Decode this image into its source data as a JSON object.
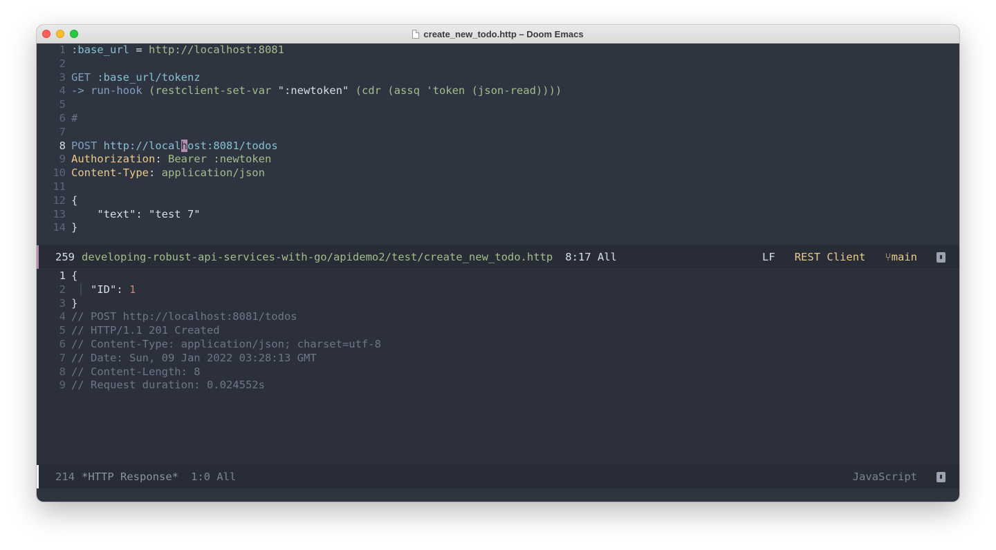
{
  "window": {
    "title": "create_new_todo.http – Doom Emacs"
  },
  "editor": {
    "lines": [
      {
        "n": "1",
        "segments": [
          {
            "t": ":base_url",
            "c": "var"
          },
          {
            "t": " = ",
            "c": "punc"
          },
          {
            "t": "http://localhost:8081",
            "c": "str"
          }
        ]
      },
      {
        "n": "2",
        "segments": []
      },
      {
        "n": "3",
        "segments": [
          {
            "t": "GET",
            "c": "kw"
          },
          {
            "t": " :base_url/tokenz",
            "c": "url"
          }
        ]
      },
      {
        "n": "4",
        "segments": [
          {
            "t": "->",
            "c": "kw"
          },
          {
            "t": " run-hook ",
            "c": "fn"
          },
          {
            "t": "(restclient-set-var ",
            "c": "str"
          },
          {
            "t": "\":newtoken\"",
            "c": "punc"
          },
          {
            "t": " (cdr (assq 'token (json-read))))",
            "c": "str"
          }
        ]
      },
      {
        "n": "5",
        "segments": []
      },
      {
        "n": "6",
        "segments": [
          {
            "t": "#",
            "c": "cmt"
          }
        ]
      },
      {
        "n": "7",
        "segments": []
      },
      {
        "n": "8",
        "current": true,
        "segments": [
          {
            "t": "POST",
            "c": "kw"
          },
          {
            "t": " http://local",
            "c": "url"
          },
          {
            "t": "h",
            "c": "cursor"
          },
          {
            "t": "ost:8081/todos",
            "c": "url"
          }
        ]
      },
      {
        "n": "9",
        "segments": [
          {
            "t": "Authorization",
            "c": "hdr"
          },
          {
            "t": ": ",
            "c": "punc"
          },
          {
            "t": "Bearer :newtoken",
            "c": "str"
          }
        ]
      },
      {
        "n": "10",
        "segments": [
          {
            "t": "Content-Type",
            "c": "hdr"
          },
          {
            "t": ": ",
            "c": "punc"
          },
          {
            "t": "application/json",
            "c": "str"
          }
        ]
      },
      {
        "n": "11",
        "segments": []
      },
      {
        "n": "12",
        "segments": [
          {
            "t": "{",
            "c": "punc"
          }
        ]
      },
      {
        "n": "13",
        "segments": [
          {
            "t": "    \"text\": \"test 7\"",
            "c": "punc"
          }
        ]
      },
      {
        "n": "14",
        "segments": [
          {
            "t": "}",
            "c": "punc"
          }
        ]
      }
    ]
  },
  "modeline_top": {
    "count": "259",
    "path": "developing-robust-api-services-with-go/apidemo2/test/create_new_todo.http",
    "position": "8:17 All",
    "eol": "LF",
    "mode": "REST Client",
    "branch": "main",
    "branch_icon": "git-branch-icon"
  },
  "response": {
    "lines": [
      {
        "n": "1",
        "current": true,
        "segments": [
          {
            "t": "{",
            "c": "punc"
          }
        ]
      },
      {
        "n": "2",
        "segments": [
          {
            "t": " │ ",
            "c": "guide"
          },
          {
            "t": "\"ID\"",
            "c": "punc"
          },
          {
            "t": ": ",
            "c": "punc"
          },
          {
            "t": "1",
            "c": "num"
          }
        ]
      },
      {
        "n": "3",
        "segments": [
          {
            "t": "}",
            "c": "punc"
          }
        ]
      },
      {
        "n": "4",
        "segments": [
          {
            "t": "// POST http://localhost:8081/todos",
            "c": "cmt"
          }
        ]
      },
      {
        "n": "5",
        "segments": [
          {
            "t": "// HTTP/1.1 201 Created",
            "c": "cmt"
          }
        ]
      },
      {
        "n": "6",
        "segments": [
          {
            "t": "// Content-Type: application/json; charset=utf-8",
            "c": "cmt"
          }
        ]
      },
      {
        "n": "7",
        "segments": [
          {
            "t": "// Date: Sun, 09 Jan 2022 03:28:13 GMT",
            "c": "cmt"
          }
        ]
      },
      {
        "n": "8",
        "segments": [
          {
            "t": "// Content-Length: 8",
            "c": "cmt"
          }
        ]
      },
      {
        "n": "9",
        "segments": [
          {
            "t": "// Request duration: 0.024552s",
            "c": "cmt"
          }
        ]
      }
    ]
  },
  "modeline_bottom": {
    "count": "214",
    "buffer": "*HTTP Response*",
    "position": "1:0 All",
    "mode": "JavaScript"
  }
}
